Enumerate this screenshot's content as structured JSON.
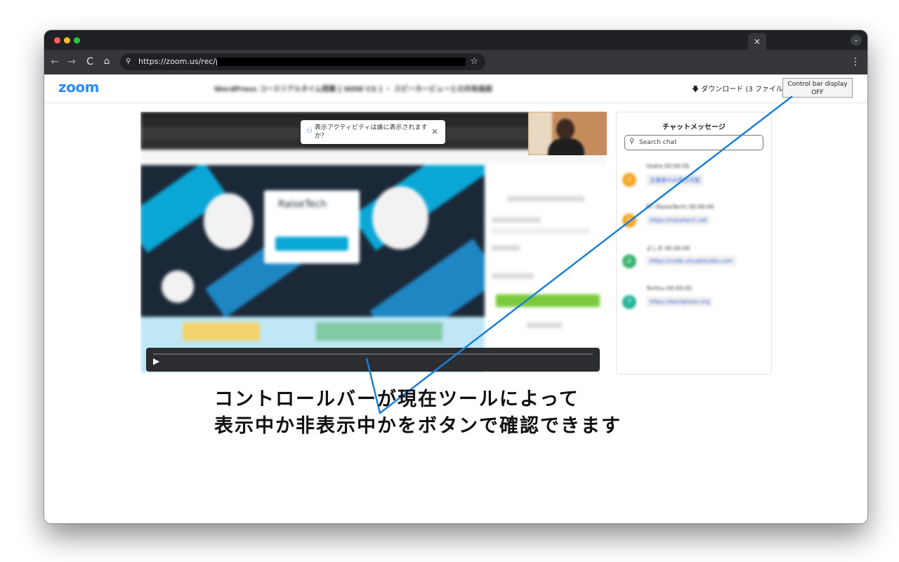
{
  "browser": {
    "url": "https://zoom.us/rec/play/",
    "tab_close": "×",
    "tab_menu": "⌄",
    "nav_back": "←",
    "nav_forward": "→",
    "nav_reload": "C",
    "nav_home": "⌂",
    "site_info": "⚲",
    "star": "☆",
    "menu": "⋮"
  },
  "zoom_page": {
    "logo": "zoom",
    "recording_title": "WordPress コースリアルタイム授業 [ HOW CS ] ・ スピーカービューとの共有画面",
    "download_label": "ダウンロード (3 ファイル)",
    "control_bar_button": {
      "line1": "Control bar display",
      "line2": "OFF"
    },
    "activity_popup": {
      "text": "表示アクティビティは誰に表示されますか？",
      "close": "×"
    },
    "shared_screen": {
      "brand": "RaiseTech"
    },
    "player": {
      "play": "▶"
    }
  },
  "chat": {
    "title": "チャットメッセージ",
    "search_placeholder": "Search chat",
    "messages": [
      {
        "name": "Usata",
        "time": "00:00:00",
        "text": "主催者のみ表示可能",
        "color": "#f5a623"
      },
      {
        "name": "RT (RaiseTech)",
        "time": "00:00:00",
        "text": "https://raisetech.net",
        "color": "#f5a623"
      },
      {
        "name": "よしき",
        "time": "00:00:00",
        "text": "https://code.visualstudio.com",
        "color": "#3cb371"
      },
      {
        "name": "Toritsu",
        "time": "00:00:00",
        "text": "https://wordpress.org",
        "color": "#2bb59a"
      }
    ]
  },
  "annotation": {
    "line1": "コントロールバーが現在ツールによって",
    "line2": "表示中か非表示中かをボタンで確認できます",
    "color": "#1a7fd6"
  }
}
